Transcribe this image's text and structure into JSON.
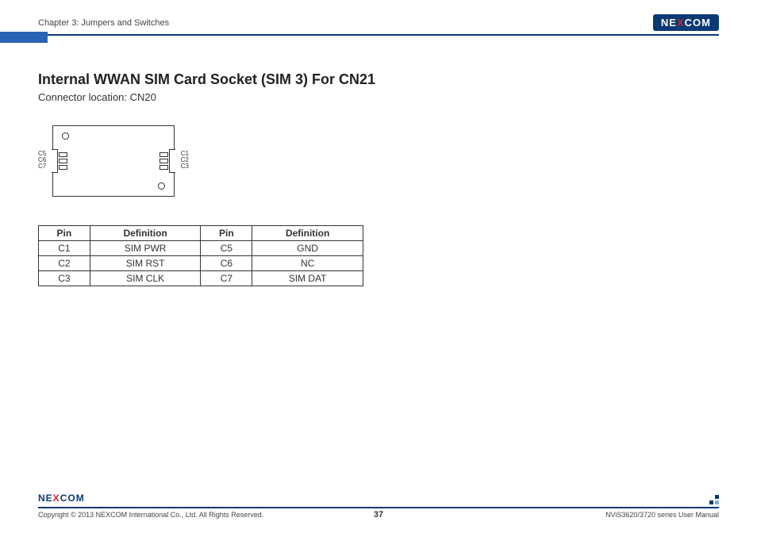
{
  "header": {
    "chapter": "Chapter 3: Jumpers and Switches",
    "logo_left": "NE",
    "logo_x": "X",
    "logo_right": "COM"
  },
  "main": {
    "title": "Internal WWAN SIM Card Socket (SIM 3) For CN21",
    "subtitle": "Connector location: CN20"
  },
  "diagram": {
    "left_labels": [
      "C5",
      "C6",
      "C7"
    ],
    "right_labels": [
      "C1",
      "C2",
      "C3"
    ]
  },
  "table": {
    "headers": [
      "Pin",
      "Definition",
      "Pin",
      "Definition"
    ],
    "rows": [
      [
        "C1",
        "SIM PWR",
        "C5",
        "GND"
      ],
      [
        "C2",
        "SIM RST",
        "C6",
        "NC"
      ],
      [
        "C3",
        "SIM CLK",
        "C7",
        "SIM DAT"
      ]
    ]
  },
  "footer": {
    "copyright": "Copyright © 2013 NEXCOM International Co., Ltd. All Rights Reserved.",
    "page": "37",
    "manual": "NViS3620/3720 series User Manual",
    "logo_left": "NE",
    "logo_x": "X",
    "logo_right": "COM"
  }
}
